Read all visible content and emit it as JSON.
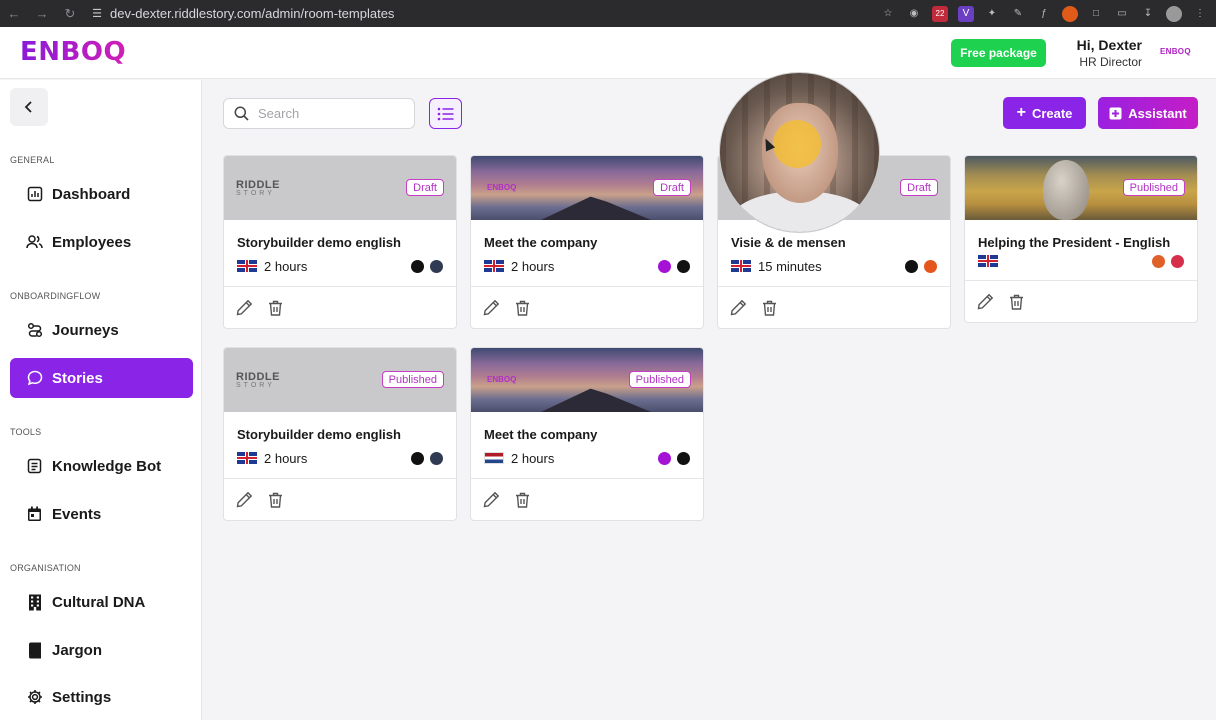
{
  "browser": {
    "url": "dev-dexter.riddlestory.com/admin/room-templates",
    "badge_count": "22"
  },
  "header": {
    "logo": "ENBOQ",
    "free_package": "Free package",
    "greeting": "Hi, Dexter",
    "role": "HR Director",
    "mini_logo": "ENBOQ"
  },
  "sidebar": {
    "sections": {
      "general": "GENERAL",
      "onboarding": "ONBOARDINGFLOW",
      "tools": "TOOLS",
      "organisation": "ORGANISATION"
    },
    "items": [
      {
        "label": "Dashboard",
        "icon": "chart-icon"
      },
      {
        "label": "Employees",
        "icon": "users-icon"
      },
      {
        "label": "Journeys",
        "icon": "route-icon"
      },
      {
        "label": "Stories",
        "icon": "chat-bubble-icon",
        "active": true
      },
      {
        "label": "Knowledge Bot",
        "icon": "document-icon"
      },
      {
        "label": "Events",
        "icon": "calendar-icon"
      },
      {
        "label": "Cultural DNA",
        "icon": "building-icon"
      },
      {
        "label": "Jargon",
        "icon": "book-icon"
      },
      {
        "label": "Settings",
        "icon": "gear-icon"
      }
    ]
  },
  "toolbar": {
    "search_placeholder": "Search",
    "create_label": "Create",
    "assistant_label": "Assistant"
  },
  "stories": [
    {
      "title": "Storybuilder demo english",
      "status": "Draft",
      "duration": "2 hours",
      "flag": "uk",
      "thumb": "riddle",
      "colors": [
        "#111111",
        "#2f3b52"
      ]
    },
    {
      "title": "Meet the company",
      "status": "Draft",
      "duration": "2 hours",
      "flag": "uk",
      "thumb": "sunset",
      "colors": [
        "#a611d6",
        "#111111"
      ]
    },
    {
      "title": "Visie & de mensen",
      "status": "Draft",
      "duration": "15 minutes",
      "flag": "uk",
      "thumb": "gray",
      "colors": [
        "#111111",
        "#e5561c"
      ]
    },
    {
      "title": "Helping the President - English",
      "status": "Published",
      "duration": "",
      "flag": "uk",
      "thumb": "desert",
      "colors": [
        "#e0602a",
        "#d62f4a"
      ]
    },
    {
      "title": "Storybuilder demo english",
      "status": "Published",
      "duration": "2 hours",
      "flag": "uk",
      "thumb": "riddle",
      "colors": [
        "#111111",
        "#2f3b52"
      ]
    },
    {
      "title": "Meet the company",
      "status": "Published",
      "duration": "2 hours",
      "flag": "nl",
      "thumb": "sunset",
      "colors": [
        "#a611d6",
        "#111111"
      ]
    }
  ],
  "thumb_text": {
    "riddle_top": "RIDDLE",
    "riddle_bottom": "STORY",
    "tiny_logo": "ENBOQ"
  },
  "colors": {
    "accent": "#8a24e6",
    "badge": "#b233c4",
    "free": "#1ed24f"
  }
}
